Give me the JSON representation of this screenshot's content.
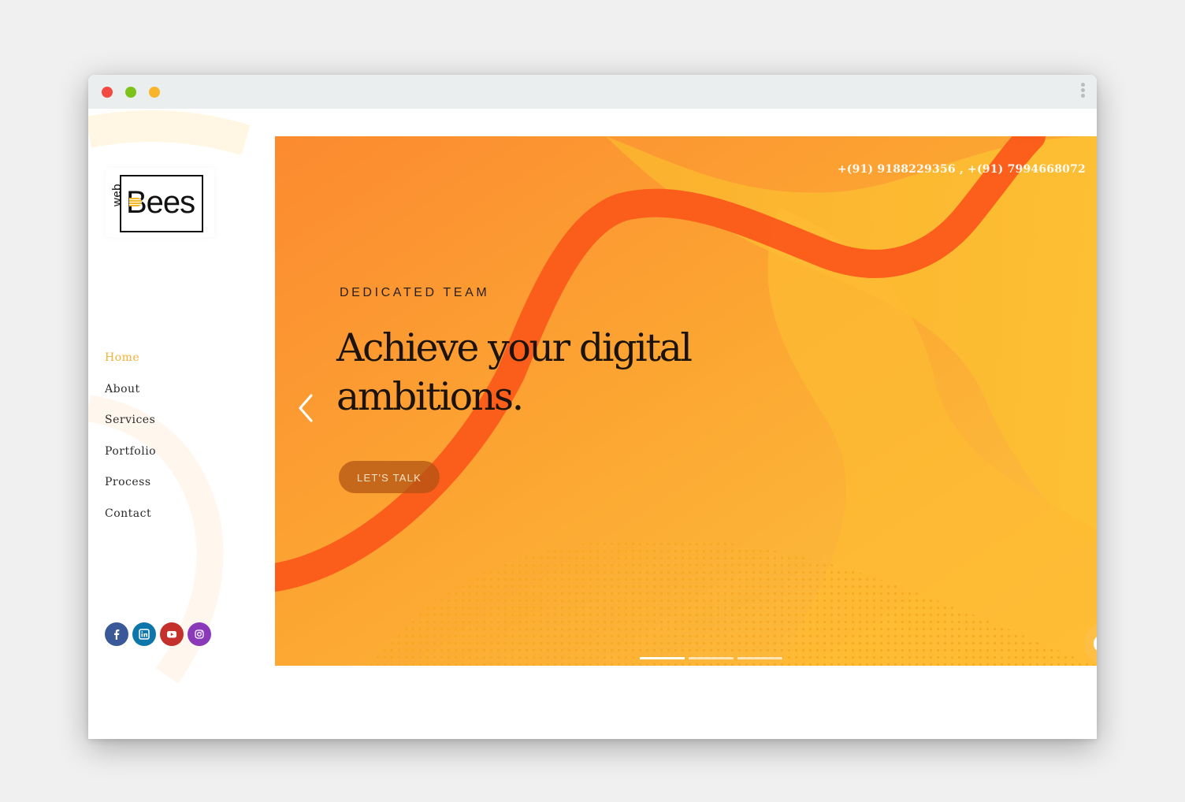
{
  "window": {
    "controls": [
      "close",
      "minimize",
      "maximize"
    ],
    "colors": {
      "close": "#f24a42",
      "minimize": "#7bc31a",
      "maximize": "#f8b52c"
    },
    "menu_icon": "kebab-menu-icon"
  },
  "brand": {
    "logo_small": "web",
    "logo_main": "Bees",
    "accent": "#f2b13a"
  },
  "nav": {
    "items": [
      {
        "label": "Home",
        "active": true
      },
      {
        "label": "About",
        "active": false
      },
      {
        "label": "Services",
        "active": false
      },
      {
        "label": "Portfolio",
        "active": false
      },
      {
        "label": "Process",
        "active": false
      },
      {
        "label": "Contact",
        "active": false
      }
    ]
  },
  "socials": [
    {
      "icon": "facebook-icon",
      "color": "#3b5998"
    },
    {
      "icon": "linkedin-icon",
      "color": "#0e76a8"
    },
    {
      "icon": "youtube-icon",
      "color": "#c4302b"
    },
    {
      "icon": "instagram-icon",
      "color": "#8a3ab9"
    }
  ],
  "hero": {
    "phone": "+(91) 9188229356 , +(91) 7994668072",
    "eyebrow": "DEDICATED TEAM",
    "title": "Achieve your digital ambitions.",
    "cta": "LET'S TALK",
    "slides": 3,
    "active_slide": 1,
    "colors": {
      "orange": "#fc9733",
      "yellow": "#fdbb33",
      "ribbon": "#fb5a1a"
    }
  }
}
